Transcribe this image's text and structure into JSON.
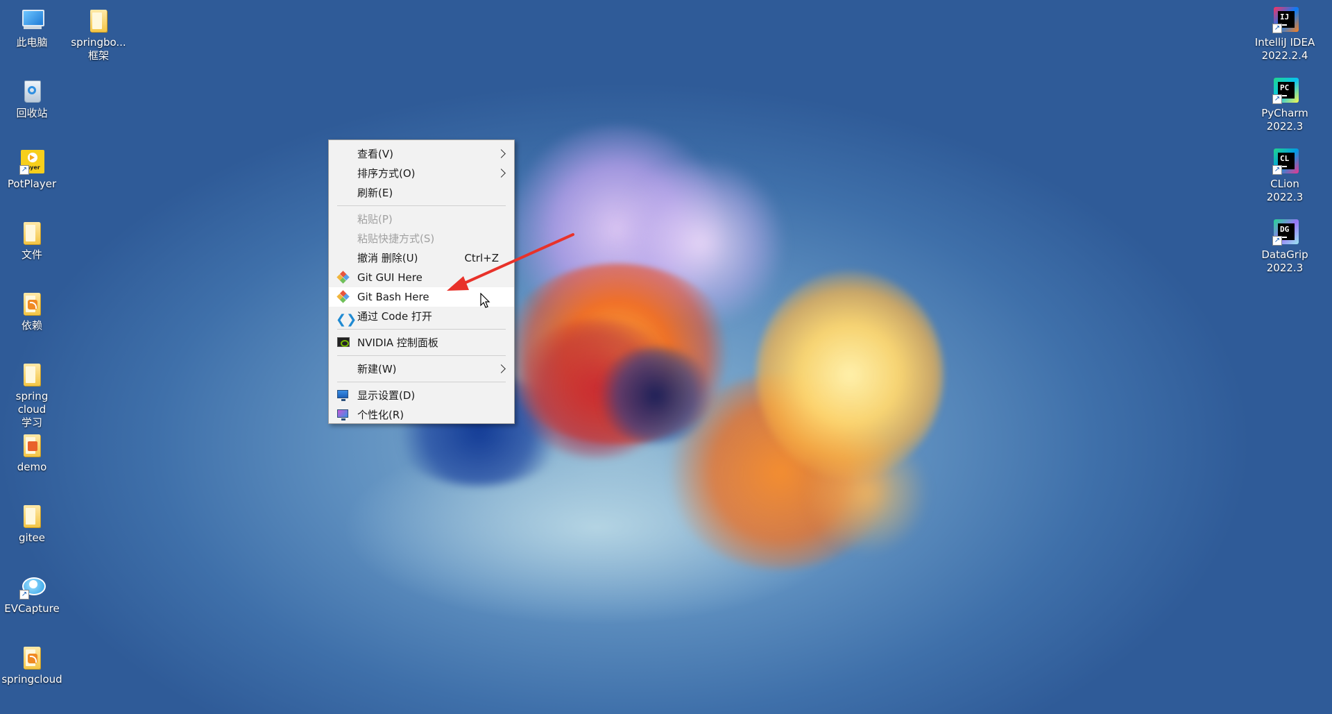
{
  "desktop": {
    "icons_left": [
      {
        "label": "此电脑",
        "icon": "this-pc-icon",
        "kind": "pc"
      },
      {
        "label": "回收站",
        "icon": "recycle-bin-icon",
        "kind": "bin"
      },
      {
        "label": "PotPlayer",
        "icon": "potplayer-icon",
        "kind": "pot"
      },
      {
        "label": "文件",
        "icon": "folder-icon",
        "kind": "folder"
      },
      {
        "label": "依赖",
        "icon": "rss-folder-icon",
        "kind": "rss"
      },
      {
        "label": "spring cloud\n学习",
        "icon": "folder-icon",
        "kind": "folder"
      },
      {
        "label": "demo",
        "icon": "folder-icon",
        "kind": "pdf"
      },
      {
        "label": "gitee",
        "icon": "folder-icon",
        "kind": "folder"
      },
      {
        "label": "EVCapture",
        "icon": "evcapture-icon",
        "kind": "ev"
      },
      {
        "label": "springcloud",
        "icon": "rss-folder-icon",
        "kind": "rss"
      }
    ],
    "icon_col2": {
      "label": "springbo...\n框架",
      "icon": "folder-icon"
    },
    "icons_right": [
      {
        "label": "IntelliJ IDEA\n2022.2.4",
        "abbr": "IJ",
        "icon": "intellij-idea-icon",
        "colors": [
          "#fe315d",
          "#087cfa",
          "#fc801d"
        ]
      },
      {
        "label": "PyCharm\n2022.3",
        "abbr": "PC",
        "icon": "pycharm-icon",
        "colors": [
          "#21d789",
          "#07c3f2",
          "#fcf84a"
        ]
      },
      {
        "label": "CLion\n2022.3",
        "abbr": "CL",
        "icon": "clion-icon",
        "colors": [
          "#21d789",
          "#009ae5",
          "#ed358c"
        ]
      },
      {
        "label": "DataGrip\n2022.3",
        "abbr": "DG",
        "icon": "datagrip-icon",
        "colors": [
          "#22d88f",
          "#9775f8",
          "#9ae5f0"
        ]
      }
    ]
  },
  "context_menu": {
    "items": [
      {
        "type": "item",
        "label": "查看(V)",
        "submenu": true
      },
      {
        "type": "item",
        "label": "排序方式(O)",
        "submenu": true
      },
      {
        "type": "item",
        "label": "刷新(E)"
      },
      {
        "type": "separator"
      },
      {
        "type": "item",
        "label": "粘贴(P)",
        "disabled": true
      },
      {
        "type": "item",
        "label": "粘贴快捷方式(S)",
        "disabled": true
      },
      {
        "type": "item",
        "label": "撤消 删除(U)",
        "shortcut": "Ctrl+Z"
      },
      {
        "type": "item",
        "label": "Git GUI Here",
        "icon": "git-icon"
      },
      {
        "type": "item",
        "label": "Git Bash Here",
        "icon": "git-icon",
        "hover": true
      },
      {
        "type": "item",
        "label": "通过 Code 打开",
        "icon": "vscode-icon"
      },
      {
        "type": "separator"
      },
      {
        "type": "item",
        "label": "NVIDIA 控制面板",
        "icon": "nvidia-icon"
      },
      {
        "type": "separator"
      },
      {
        "type": "item",
        "label": "新建(W)",
        "submenu": true
      },
      {
        "type": "separator"
      },
      {
        "type": "item",
        "label": "显示设置(D)",
        "icon": "display-settings-icon"
      },
      {
        "type": "item",
        "label": "个性化(R)",
        "icon": "personalize-icon"
      }
    ]
  },
  "annotation": {
    "color": "#e8322a"
  }
}
